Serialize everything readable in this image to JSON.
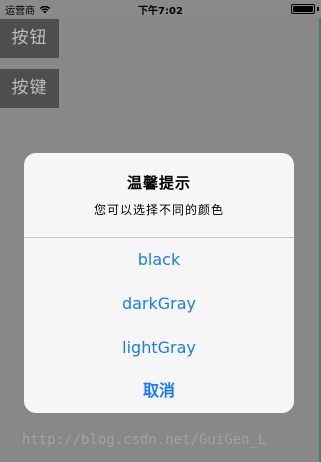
{
  "status_bar": {
    "carrier": "运营商",
    "time": "下午7:02",
    "wifi_icon": "wifi-icon",
    "battery_icon": "battery-icon",
    "battery_level": 1.0
  },
  "background_buttons": [
    {
      "label": "按钮"
    },
    {
      "label": "按键"
    }
  ],
  "alert": {
    "title": "温馨提示",
    "message": "您可以选择不同的颜色",
    "actions": [
      {
        "label": "black"
      },
      {
        "label": "darkGray"
      },
      {
        "label": "lightGray"
      },
      {
        "label": "取消"
      }
    ]
  },
  "watermark": "http://blog.csdn.net/GuiGen_L",
  "colors": {
    "overlay": "#888888",
    "alert_background": "#f6f6f6",
    "action_text": "#1a7cf5",
    "button_background": "#4e4e4e"
  }
}
